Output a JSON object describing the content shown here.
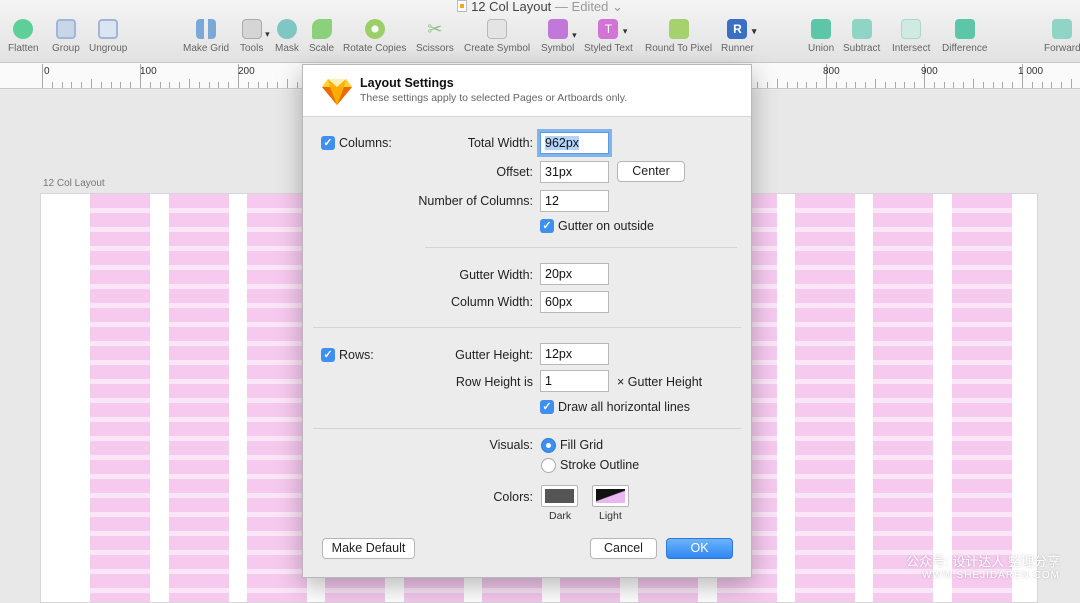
{
  "window": {
    "document_name": "12 Col Layout",
    "document_status": "— Edited"
  },
  "toolbar": {
    "items": [
      {
        "label": "Flatten",
        "icon": "flatten-icon",
        "color": "#5fcf9a"
      },
      {
        "label": "Group",
        "icon": "group-icon",
        "color": "#9fb6d6"
      },
      {
        "label": "Ungroup",
        "icon": "ungroup-icon",
        "color": "#9fb6d6"
      },
      {
        "label": "Make Grid",
        "icon": "make-grid-icon",
        "color": "#7aa9d8"
      },
      {
        "label": "Tools",
        "icon": "tools-icon",
        "color": "#b8b8b8"
      },
      {
        "label": "Mask",
        "icon": "mask-icon",
        "color": "#7fc7c2"
      },
      {
        "label": "Scale",
        "icon": "scale-icon",
        "color": "#8bd07a"
      },
      {
        "label": "Rotate Copies",
        "icon": "rotate-copies-icon",
        "color": "#9ccf6a"
      },
      {
        "label": "Scissors",
        "icon": "scissors-icon",
        "color": "#8ac47a"
      },
      {
        "label": "Create Symbol",
        "icon": "create-symbol-icon",
        "color": "#b9b9b9"
      },
      {
        "label": "Symbol",
        "icon": "symbol-icon",
        "color": "#c178d8"
      },
      {
        "label": "Styled Text",
        "icon": "styled-text-icon",
        "color": "#d174d6"
      },
      {
        "label": "Round To Pixel",
        "icon": "round-to-pixel-icon",
        "color": "#a5d26f"
      },
      {
        "label": "Runner",
        "icon": "runner-icon",
        "color": "#3a6fc4"
      },
      {
        "label": "Union",
        "icon": "union-icon",
        "color": "#5cc6a8"
      },
      {
        "label": "Subtract",
        "icon": "subtract-icon",
        "color": "#8fd4c4"
      },
      {
        "label": "Intersect",
        "icon": "intersect-icon",
        "color": "#a8d9cc"
      },
      {
        "label": "Difference",
        "icon": "difference-icon",
        "color": "#5cc6a8"
      },
      {
        "label": "Forward",
        "icon": "forward-icon",
        "color": "#8fd4c4"
      }
    ]
  },
  "ruler": {
    "labels": [
      "0",
      "100",
      "200",
      "800",
      "900",
      "1 000"
    ]
  },
  "canvas": {
    "artboard_label": "12 Col Layout",
    "grid_fill_color": "#f6c9ee"
  },
  "dialog": {
    "title": "Layout Settings",
    "subtitle": "These settings apply to selected Pages or Artboards only.",
    "columns": {
      "checkbox_label": "Columns:",
      "total_width_label": "Total Width:",
      "total_width_value": "962px",
      "offset_label": "Offset:",
      "offset_value": "31px",
      "center_button": "Center",
      "number_label": "Number of Columns:",
      "number_value": "12",
      "gutter_outside_label": "Gutter on outside",
      "gutter_width_label": "Gutter Width:",
      "gutter_width_value": "20px",
      "column_width_label": "Column Width:",
      "column_width_value": "60px"
    },
    "rows": {
      "checkbox_label": "Rows:",
      "gutter_height_label": "Gutter Height:",
      "gutter_height_value": "12px",
      "row_height_label": "Row Height is",
      "row_height_value": "1",
      "row_height_suffix": "× Gutter Height",
      "draw_lines_label": "Draw all horizontal lines"
    },
    "visuals": {
      "label": "Visuals:",
      "fill_grid": "Fill Grid",
      "stroke_outline": "Stroke Outline"
    },
    "colors": {
      "label": "Colors:",
      "dark_caption": "Dark",
      "light_caption": "Light",
      "dark_color": "#555555",
      "light_color": "#e9b8f2"
    },
    "buttons": {
      "make_default": "Make Default",
      "cancel": "Cancel",
      "ok": "OK"
    }
  },
  "watermark": {
    "line1": "公众号: 设计达人 整理分享",
    "line2": "WWW.SHEJIDAREN.COM"
  }
}
